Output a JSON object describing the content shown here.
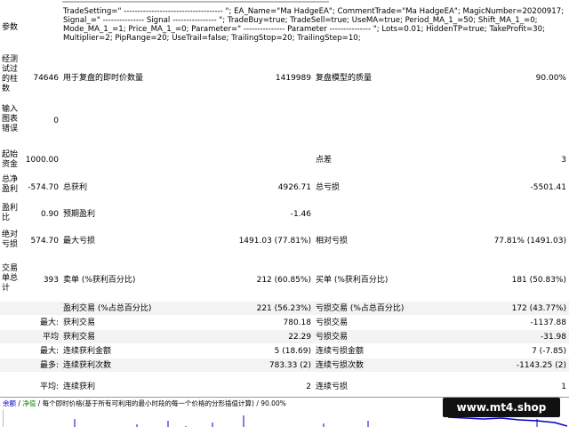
{
  "params": {
    "label": "参数",
    "text": "TradeSetting=\" ------------------------------------ \"; EA_Name=\"Ma HadgeEA\"; CommentTrade=\"Ma HadgeEA\"; MagicNumber=20200917; Signal_=\" --------------- Signal ---------------- \"; TradeBuy=true; TradeSell=true; UseMA=true; Period_MA_1_=50; Shift_MA_1_=0; Mode_MA_1_=1; Price_MA_1_=0; Parameter=\" --------------- Parameter --------------- \"; Lots=0.01; HiddenTP=true; TakeProfit=30; Multiplier=2; PipRange=20; UseTrail=false; TrailingStop=20; TrailingStep=10;"
  },
  "bars": {
    "label": "经测试过的柱数",
    "value": "74646",
    "ticks_label": "用于复盘的即时价数量",
    "ticks_value": "1419989",
    "quality_label": "复盘模型的质量",
    "quality_value": "90.00%"
  },
  "chart_errors": {
    "label": "输入图表错误",
    "value": "0"
  },
  "deposit": {
    "label": "起始资金",
    "value": "1000.00",
    "spread_label": "点差",
    "spread_value": "3"
  },
  "net_profit": {
    "label": "总净盈利",
    "value": "-574.70",
    "gross_profit_label": "总获利",
    "gross_profit_value": "4926.71",
    "gross_loss_label": "总亏损",
    "gross_loss_value": "-5501.41"
  },
  "profit_factor": {
    "label": "盈利比",
    "value": "0.90",
    "expected_label": "预期盈利",
    "expected_value": "-1.46"
  },
  "drawdown": {
    "label": "绝对亏损",
    "value": "574.70",
    "max_label": "最大亏损",
    "max_value": "1491.03 (77.81%)",
    "rel_label": "相对亏损",
    "rel_value": "77.81% (1491.03)"
  },
  "trades": {
    "label": "交易单总计",
    "value": "393",
    "short_label": "卖单 (%获利百分比)",
    "short_value": "212 (60.85%)",
    "long_label": "买单 (%获利百分比)",
    "long_value": "181 (50.83%)"
  },
  "stats": [
    {
      "pre": "",
      "l1": "盈利交易 (%占总百分比)",
      "v1": "221 (56.23%)",
      "l2": "亏损交易 (%占总百分比)",
      "v2": "172 (43.77%)"
    },
    {
      "pre": "最大:",
      "l1": "获利交易",
      "v1": "780.18",
      "l2": "亏损交易",
      "v2": "-1137.88"
    },
    {
      "pre": "平均",
      "l1": "获利交易",
      "v1": "22.29",
      "l2": "亏损交易",
      "v2": "-31.98"
    },
    {
      "pre": "最大:",
      "l1": "连续获利金额",
      "v1": "5 (18.69)",
      "l2": "连续亏损金额",
      "v2": "7 (-7.85)"
    },
    {
      "pre": "最多:",
      "l1": "连续获利次数",
      "v1": "783.33 (2)",
      "l2": "连续亏损次数",
      "v2": "-1143.25 (2)"
    },
    {
      "pre": "平均:",
      "l1": "连续获利",
      "v1": "2",
      "l2": "连续亏损",
      "v2": "1"
    }
  ],
  "graph": {
    "tab1": "余额",
    "tab2": "净值",
    "caption": "/ 每个即时价格(基于所有可利用的最小时段的每一个价格的分形插值计算) / 90.00%"
  },
  "watermark": "www.mt4.shop",
  "colors": {
    "balance_line": "#0000cc",
    "row_alt": "#f3f3f3"
  }
}
